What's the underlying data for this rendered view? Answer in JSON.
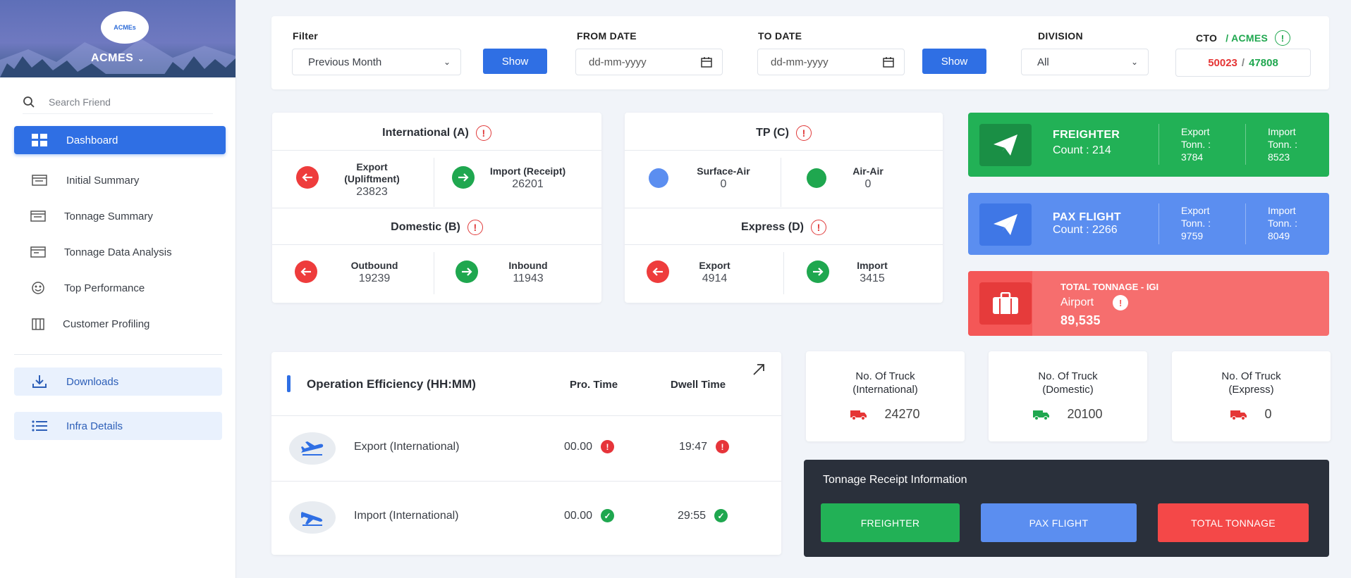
{
  "sidebar": {
    "brand": "ACMES",
    "logo_text": "ACMEs",
    "search_placeholder": "Search Friend",
    "items": [
      {
        "label": "Dashboard"
      },
      {
        "label": "Initial Summary"
      },
      {
        "label": "Tonnage Summary"
      },
      {
        "label": "Tonnage Data Analysis"
      },
      {
        "label": "Top Performance"
      },
      {
        "label": "Customer Profiling"
      }
    ],
    "downloads": "Downloads",
    "infra": "Infra Details"
  },
  "filter": {
    "filter_label": "Filter",
    "filter_value": "Previous Month",
    "show_label": "Show",
    "from_label": "FROM DATE",
    "from_placeholder": "dd-mm-yyyy",
    "to_label": "TO DATE",
    "to_placeholder": "dd-mm-yyyy",
    "division_label": "DIVISION",
    "division_value": "All",
    "cto_label": "CTO",
    "cto_suffix": "/ ACMES",
    "cto_red": "50023",
    "cto_sep": "/",
    "cto_green": "47808"
  },
  "international": {
    "title": "International (A)",
    "export_label": "Export (Upliftment)",
    "export_value": "23823",
    "import_label": "Import (Receipt)",
    "import_value": "26201"
  },
  "domestic": {
    "title": "Domestic (B)",
    "out_label": "Outbound",
    "out_value": "19239",
    "in_label": "Inbound",
    "in_value": "11943"
  },
  "tp": {
    "title": "TP (C)",
    "sa_label": "Surface-Air",
    "sa_value": "0",
    "aa_label": "Air-Air",
    "aa_value": "0"
  },
  "express": {
    "title": "Express (D)",
    "export_label": "Export",
    "export_value": "4914",
    "import_label": "Import",
    "import_value": "3415"
  },
  "freighter": {
    "title": "FREIGHTER",
    "count": "Count : 214",
    "export_label": "Export",
    "export_unit": "Tonn. :",
    "export_value": "3784",
    "import_label": "Import",
    "import_unit": "Tonn. :",
    "import_value": "8523"
  },
  "pax": {
    "title": "PAX FLIGHT",
    "count": "Count : 2266",
    "export_label": "Export",
    "export_unit": "Tonn. :",
    "export_value": "9759",
    "import_label": "Import",
    "import_unit": "Tonn. :",
    "import_value": "8049"
  },
  "total": {
    "title": "TOTAL TONNAGE - IGI",
    "sub": "Airport",
    "value": "89,535"
  },
  "operation": {
    "title": "Operation Efficiency (HH:MM)",
    "pro_header": "Pro. Time",
    "dwell_header": "Dwell Time",
    "rows": [
      {
        "label": "Export (International)",
        "pro": "00.00",
        "dwell": "19:47"
      },
      {
        "label": "Import (International)",
        "pro": "00.00",
        "dwell": "29:55"
      }
    ]
  },
  "trucks": [
    {
      "line1": "No. Of Truck",
      "line2": "(International)",
      "value": "24270"
    },
    {
      "line1": "No. Of Truck",
      "line2": "(Domestic)",
      "value": "20100"
    },
    {
      "line1": "No. Of Truck",
      "line2": "(Express)",
      "value": "0"
    }
  ],
  "receipt": {
    "title": "Tonnage Receipt Information",
    "freighter": "FREIGHTER",
    "pax": "PAX FLIGHT",
    "total": "TOTAL TONNAGE"
  },
  "colors": {
    "primary": "#2f6fe4",
    "green": "#22b156",
    "blue": "#5b8ef0",
    "red": "#f66e6e"
  }
}
